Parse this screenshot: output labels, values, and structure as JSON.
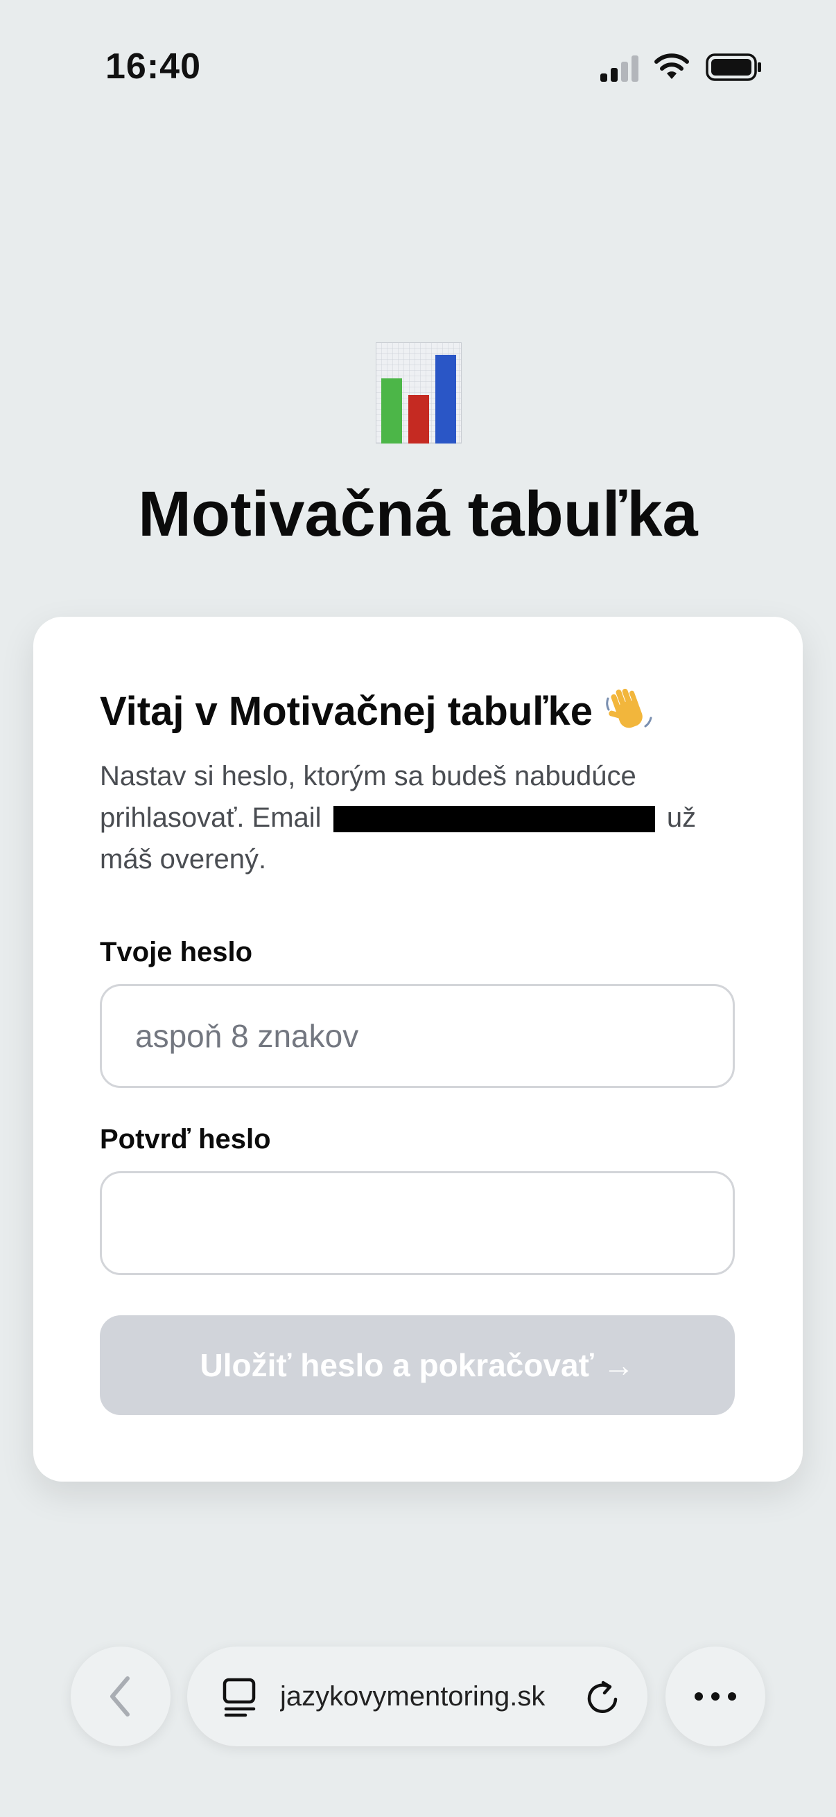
{
  "status_bar": {
    "time": "16:40",
    "icons": [
      "cellular-signal-icon",
      "wifi-icon",
      "battery-icon"
    ]
  },
  "header": {
    "logo_icon": "bar-chart-icon",
    "title": "Motivačná tabuľka"
  },
  "card": {
    "title": "Vitaj v Motivačnej tabuľke",
    "title_icon": "waving-hand-icon",
    "description_before": "Nastav si heslo, ktorým sa budeš nabudúce prihlasovať. Email",
    "description_after": "už máš overený.",
    "password_label": "Tvoje heslo",
    "password_placeholder": "aspoň 8 znakov",
    "password_value": "",
    "confirm_label": "Potvrď heslo",
    "confirm_value": "",
    "submit_label": "Uložiť heslo a pokračovať →",
    "submit_enabled": false
  },
  "browser_bar": {
    "url": "jazykovymentoring.sk",
    "back_icon": "chevron-left-icon",
    "tabs_icon": "tabs-icon",
    "reload_icon": "reload-icon",
    "more_icon": "more-icon"
  },
  "colors": {
    "background": "#e8eced",
    "card": "#ffffff",
    "button_disabled": "#d1d4da",
    "input_border": "#d3d5d9",
    "chart_green": "#4cb648",
    "chart_red": "#c52a22",
    "chart_blue": "#2a56c6"
  }
}
